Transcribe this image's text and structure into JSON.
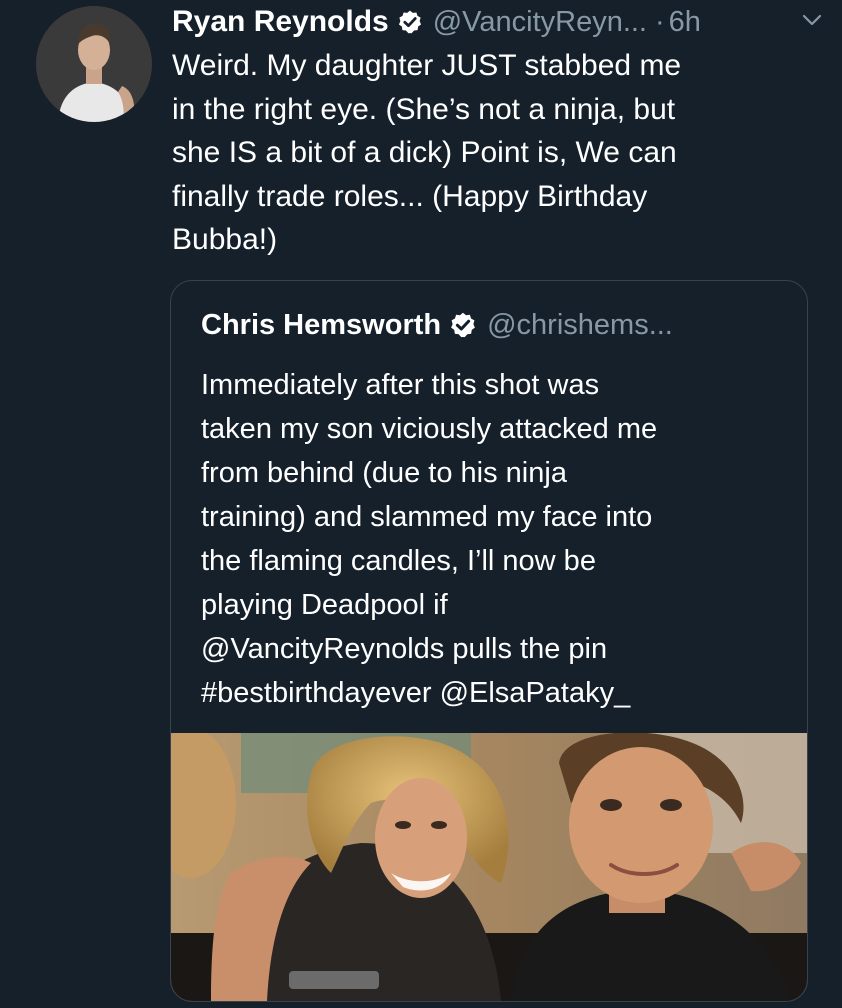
{
  "tweet": {
    "author_name": "Ryan Reynolds",
    "handle": "@VancityReyn...",
    "separator": "·",
    "time": "6h",
    "text_lines": [
      "Weird. My daughter JUST stabbed me",
      "in the right eye. (She’s not a ninja, but",
      "she IS a bit of a dick) Point is, We can",
      "finally trade roles... (Happy Birthday",
      "Bubba!)"
    ],
    "icons": {
      "avatar": "avatar",
      "verified": "verified-badge-icon",
      "menu": "chevron-down-icon"
    }
  },
  "quoted_tweet": {
    "author_name": "Chris Hemsworth",
    "handle": "@chrishems...",
    "text_lines": [
      "Immediately after this shot was",
      "taken my son viciously attacked me",
      "from behind (due to his ninja",
      "training) and slammed my face into",
      "the flaming candles, I’ll now be",
      "playing Deadpool if",
      "@VancityReynolds pulls the pin",
      "#bestbirthdayever @ElsaPataky_"
    ],
    "media": "photo"
  },
  "colors": {
    "background": "#15202b",
    "text": "#ffffff",
    "secondary_text": "#8899a6",
    "border": "#38444d",
    "verified_badge": "#ffffff"
  }
}
